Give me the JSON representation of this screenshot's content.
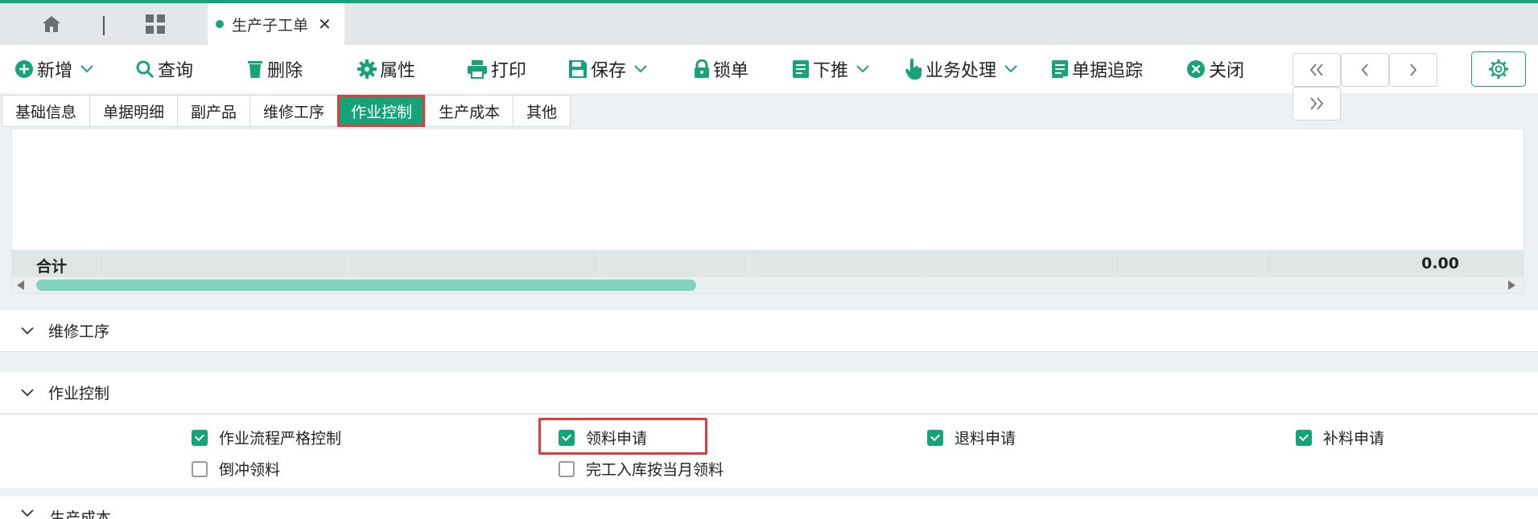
{
  "tabs": {
    "home_icon": "home-icon",
    "apps_icon": "grid-icon",
    "active_doc": "生产子工单",
    "close_glyph": "✕"
  },
  "toolbar": {
    "add": "新增",
    "query": "查询",
    "delete": "删除",
    "properties": "属性",
    "print": "打印",
    "save": "保存",
    "lock": "锁单",
    "push_down": "下推",
    "business": "业务处理",
    "trace": "单据追踪",
    "close": "关闭"
  },
  "nav": {
    "first": "«",
    "prev": "‹",
    "next": "›",
    "last": "»"
  },
  "section_tabs": [
    "基础信息",
    "单据明细",
    "副产品",
    "维修工序",
    "作业控制",
    "生产成本",
    "其他"
  ],
  "active_section": "作业控制",
  "grid": {
    "sum_label": "合计",
    "sum_value": "0.00"
  },
  "panels": {
    "repair": "维修工序",
    "control": "作业控制",
    "cost": "生产成本"
  },
  "controls": [
    {
      "label": "作业流程严格控制",
      "checked": true
    },
    {
      "label": "领料申请",
      "checked": true
    },
    {
      "label": "退料申请",
      "checked": true
    },
    {
      "label": "补料申请",
      "checked": true
    },
    {
      "label": "倒冲领料",
      "checked": false
    },
    {
      "label": "完工入库按当月领料",
      "checked": false
    }
  ],
  "colors": {
    "accent": "#16a37a",
    "highlight": "#e23b3b"
  }
}
